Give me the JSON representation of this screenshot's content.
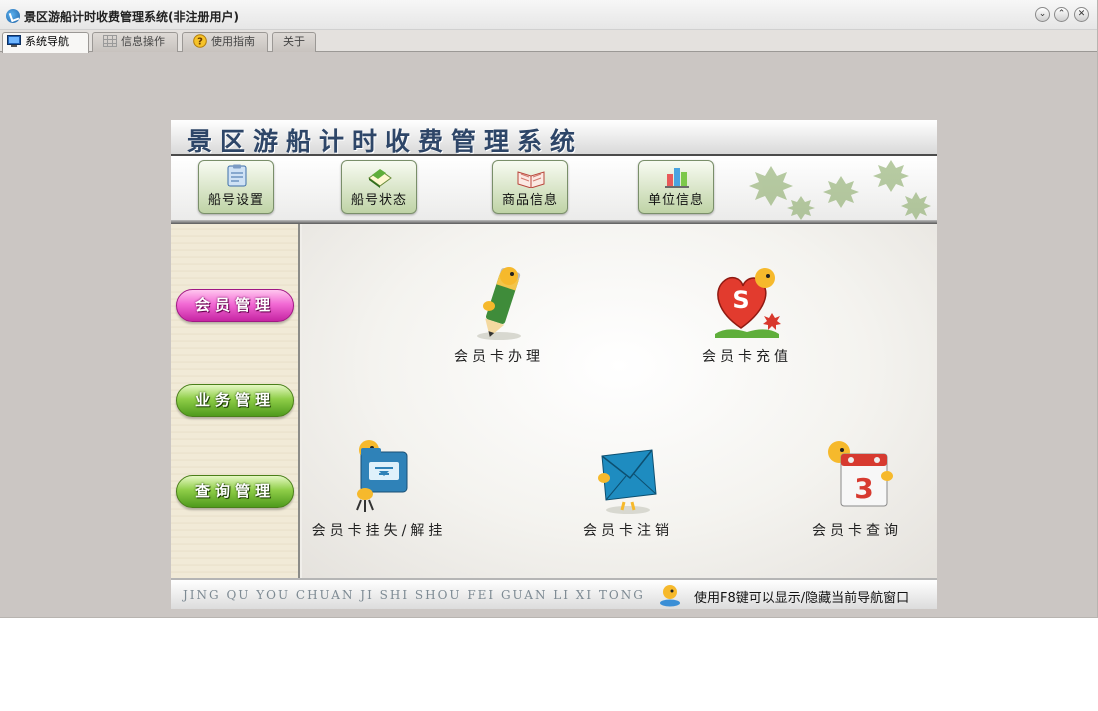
{
  "window": {
    "title": "景区游船计时收费管理系统(非注册用户)",
    "controls": [
      "minimize",
      "maximize",
      "close"
    ]
  },
  "tabs": [
    {
      "label": "系统导航",
      "icon": "monitor-icon",
      "active": true
    },
    {
      "label": "信息操作",
      "icon": "grid-icon",
      "active": false
    },
    {
      "label": "使用指南",
      "icon": "help-icon",
      "active": false
    },
    {
      "label": "关于",
      "icon": "",
      "active": false
    }
  ],
  "panel": {
    "title": "景区游船计时收费管理系统",
    "toolbar": [
      {
        "label": "船号设置",
        "icon": "clipboard-icon"
      },
      {
        "label": "船号状态",
        "icon": "book-icon"
      },
      {
        "label": "商品信息",
        "icon": "open-book-icon"
      },
      {
        "label": "单位信息",
        "icon": "building-icon"
      }
    ],
    "sidebar": [
      {
        "label": "会员管理",
        "color": "#e24dc4"
      },
      {
        "label": "业务管理",
        "color": "#6cb832"
      },
      {
        "label": "查询管理",
        "color": "#6cb832"
      }
    ],
    "features": [
      {
        "label": "会员卡办理",
        "icon": "pencil-mascot-icon"
      },
      {
        "label": "会员卡充值",
        "icon": "heart-mascot-icon"
      },
      {
        "label": "会员卡挂失/解挂",
        "icon": "folder-mascot-icon"
      },
      {
        "label": "会员卡注销",
        "icon": "envelope-mascot-icon"
      },
      {
        "label": "会员卡查询",
        "icon": "calendar-mascot-icon"
      }
    ],
    "footer": {
      "pinyin": "JING QU YOU CHUAN JI SHI SHOU FEI GUAN LI XI TONG",
      "hint": "使用F8键可以显示/隐藏当前导航窗口",
      "hint_icon": "mascot-icon"
    }
  },
  "colors": {
    "title_text": "#2e4668",
    "window_bg": "#cbc6c3",
    "accent_pink": "#e24dc4",
    "accent_green": "#6cb832"
  }
}
